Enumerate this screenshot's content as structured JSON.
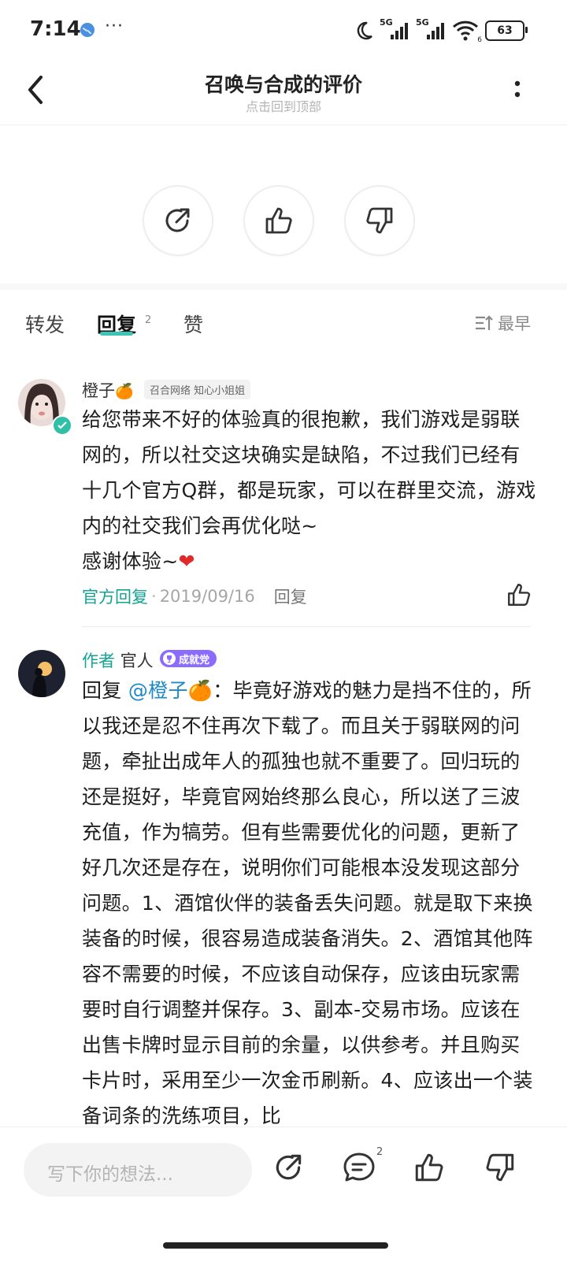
{
  "status": {
    "time": "7:14",
    "dots": "···",
    "battery": "63",
    "signal1": "5G",
    "signal2": "5G",
    "wifi_label": "6"
  },
  "header": {
    "title": "召唤与合成的评价",
    "subtitle": "点击回到顶部"
  },
  "tabs": [
    {
      "label": "转发"
    },
    {
      "label": "回复",
      "count": "2"
    },
    {
      "label": "赞"
    }
  ],
  "sort": {
    "label": "最早"
  },
  "comments": [
    {
      "name": "橙子",
      "emoji": "🍊",
      "badge": "召合网络 知心小姐姐",
      "text": "给您带来不好的体验真的很抱歉，我们游戏是弱联网的，所以社交这块确实是缺陷，不过我们已经有十几个官方Q群，都是玩家，可以在群里交流，游戏内的社交我们会再优化哒~",
      "thanks": "感谢体验~",
      "heart": "❤",
      "official": "官方回复",
      "dot": "·",
      "date": "2019/09/16",
      "reply": "回复"
    },
    {
      "author_tag": "作者",
      "name": "官人",
      "badge": "成就党",
      "reply_prefix": "回复 ",
      "mention": "@橙子🍊",
      "text": "：毕竟好游戏的魅力是挡不住的，所以我还是忍不住再次下载了。而且关于弱联网的问题，牵扯出成年人的孤独也就不重要了。回归玩的还是挺好，毕竟官网始终那么良心，所以送了三波充值，作为犒劳。但有些需要优化的问题，更新了好几次还是存在，说明你们可能根本没发现这部分问题。1、酒馆伙伴的装备丢失问题。就是取下来换装备的时候，很容易造成装备消失。2、酒馆其他阵容不需要的时候，不应该自动保存，应该由玩家需要时自行调整并保存。3、副本-交易市场。应该在出售卡牌时显示目前的余量，以供参考。并且购买卡片时，采用至少一次金币刷新。4、应该出一个装备词条的洗练项目，比"
    }
  ],
  "bottom": {
    "placeholder": "写下你的想法...",
    "comment_count": "2"
  },
  "colors": {
    "accent": "#13a393",
    "mention": "#1e88c8",
    "badge_purple": "#8b6cff"
  }
}
